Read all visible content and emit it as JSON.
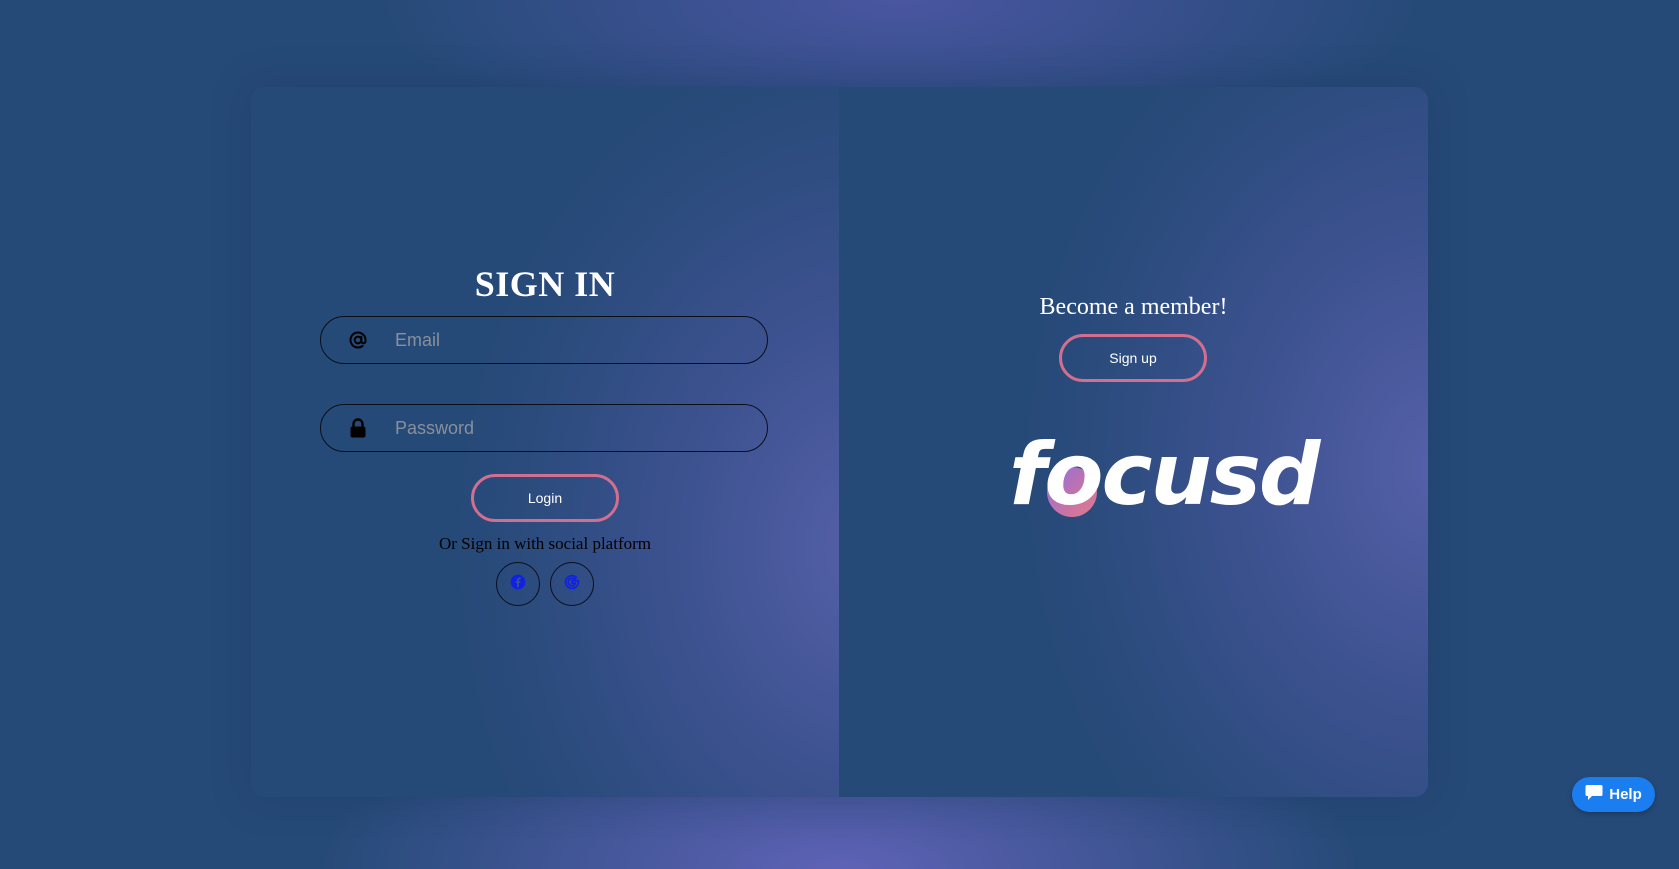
{
  "signin": {
    "title": "SIGN IN",
    "email_placeholder": "Email",
    "password_placeholder": "Password",
    "login_label": "Login",
    "social_text": "Or Sign in with social platform",
    "social": [
      {
        "name": "facebook-icon"
      },
      {
        "name": "google-icon"
      }
    ]
  },
  "signup": {
    "member_text": "Become a member!",
    "signup_label": "Sign up"
  },
  "logo": {
    "text": "focusd",
    "circle_colors": [
      "#8b6fe0",
      "#e07a8c"
    ]
  },
  "help": {
    "label": "Help"
  },
  "colors": {
    "background": "#264a78",
    "button_border": "#d06f8e",
    "help_button": "#1b7ef0",
    "social_icon": "#1020e8"
  }
}
